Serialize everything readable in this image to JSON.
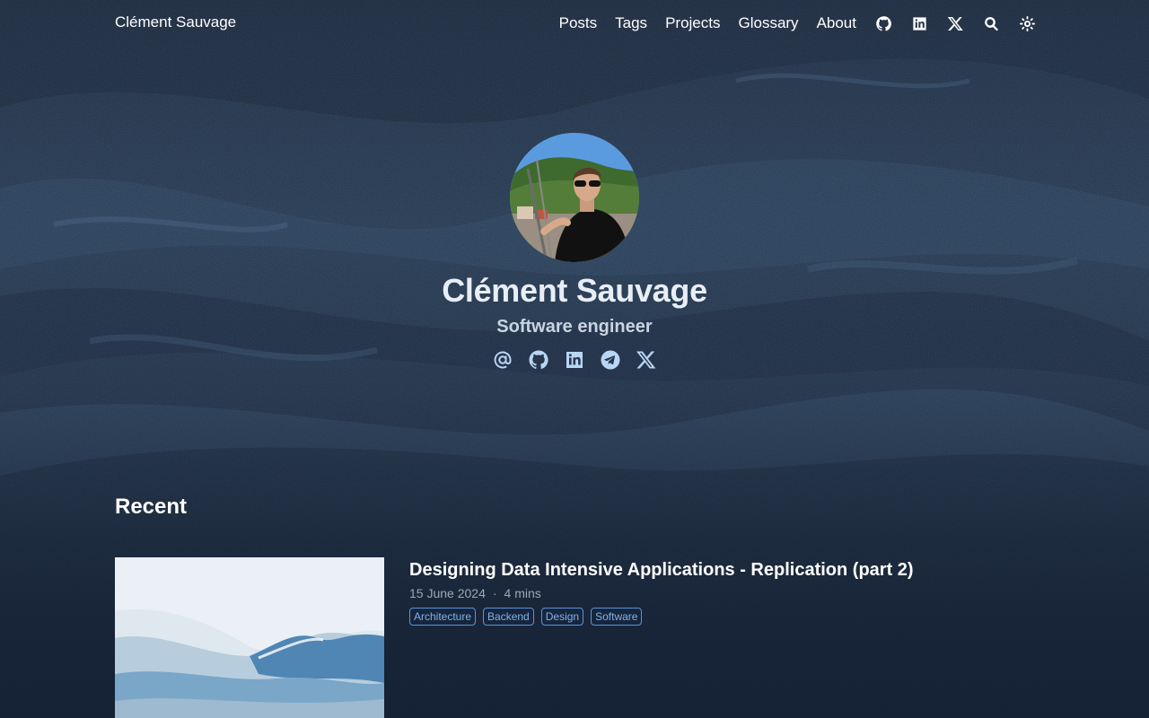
{
  "header": {
    "brand": "Clément Sauvage",
    "nav": [
      "Posts",
      "Tags",
      "Projects",
      "Glossary",
      "About"
    ],
    "icons": [
      "github-icon",
      "linkedin-icon",
      "x-icon",
      "search-icon",
      "theme-toggle-icon"
    ]
  },
  "hero": {
    "name": "Clément Sauvage",
    "role": "Software engineer",
    "socials": [
      "email-icon",
      "github-icon",
      "linkedin-icon",
      "telegram-icon",
      "x-icon"
    ]
  },
  "recent": {
    "heading": "Recent",
    "posts": [
      {
        "title": "Designing Data Intensive Applications - Replication (part 2)",
        "date": "15 June 2024",
        "separator": "·",
        "reading_time": "4 mins",
        "tags": [
          "Architecture",
          "Backend",
          "Design",
          "Software"
        ]
      }
    ]
  },
  "colors": {
    "background": "#1f3149",
    "text": "#ffffff",
    "accent": "#b9d6f5",
    "tag": "#7fb2ec"
  }
}
